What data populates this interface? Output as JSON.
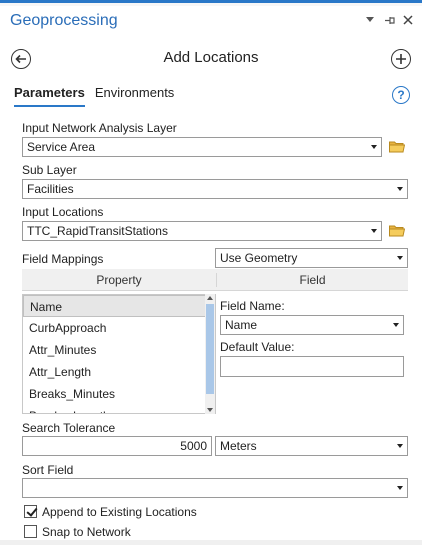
{
  "pane": {
    "title": "Geoprocessing"
  },
  "tool": {
    "title": "Add Locations"
  },
  "tabs": [
    {
      "label": "Parameters"
    },
    {
      "label": "Environments"
    }
  ],
  "params": {
    "input_layer_label": "Input Network Analysis Layer",
    "input_layer_value": "Service Area",
    "sub_layer_label": "Sub Layer",
    "sub_layer_value": "Facilities",
    "input_locations_label": "Input Locations",
    "input_locations_value": "TTC_RapidTransitStations",
    "field_mappings_label": "Field Mappings",
    "field_mappings_value": "Use Geometry",
    "property_header": "Property",
    "field_header": "Field",
    "property_list": [
      "Name",
      "CurbApproach",
      "Attr_Minutes",
      "Attr_Length",
      "Breaks_Minutes",
      "Breaks_Length"
    ],
    "field_name_label": "Field Name:",
    "field_name_value": "Name",
    "default_value_label": "Default Value:",
    "default_value": "",
    "search_tolerance_label": "Search Tolerance",
    "search_tolerance_value": "5000",
    "search_tolerance_units": "Meters",
    "sort_field_label": "Sort Field",
    "sort_field_value": "",
    "append_label": "Append to Existing Locations",
    "append_checked": true,
    "snap_label": "Snap to Network",
    "snap_checked": false
  }
}
